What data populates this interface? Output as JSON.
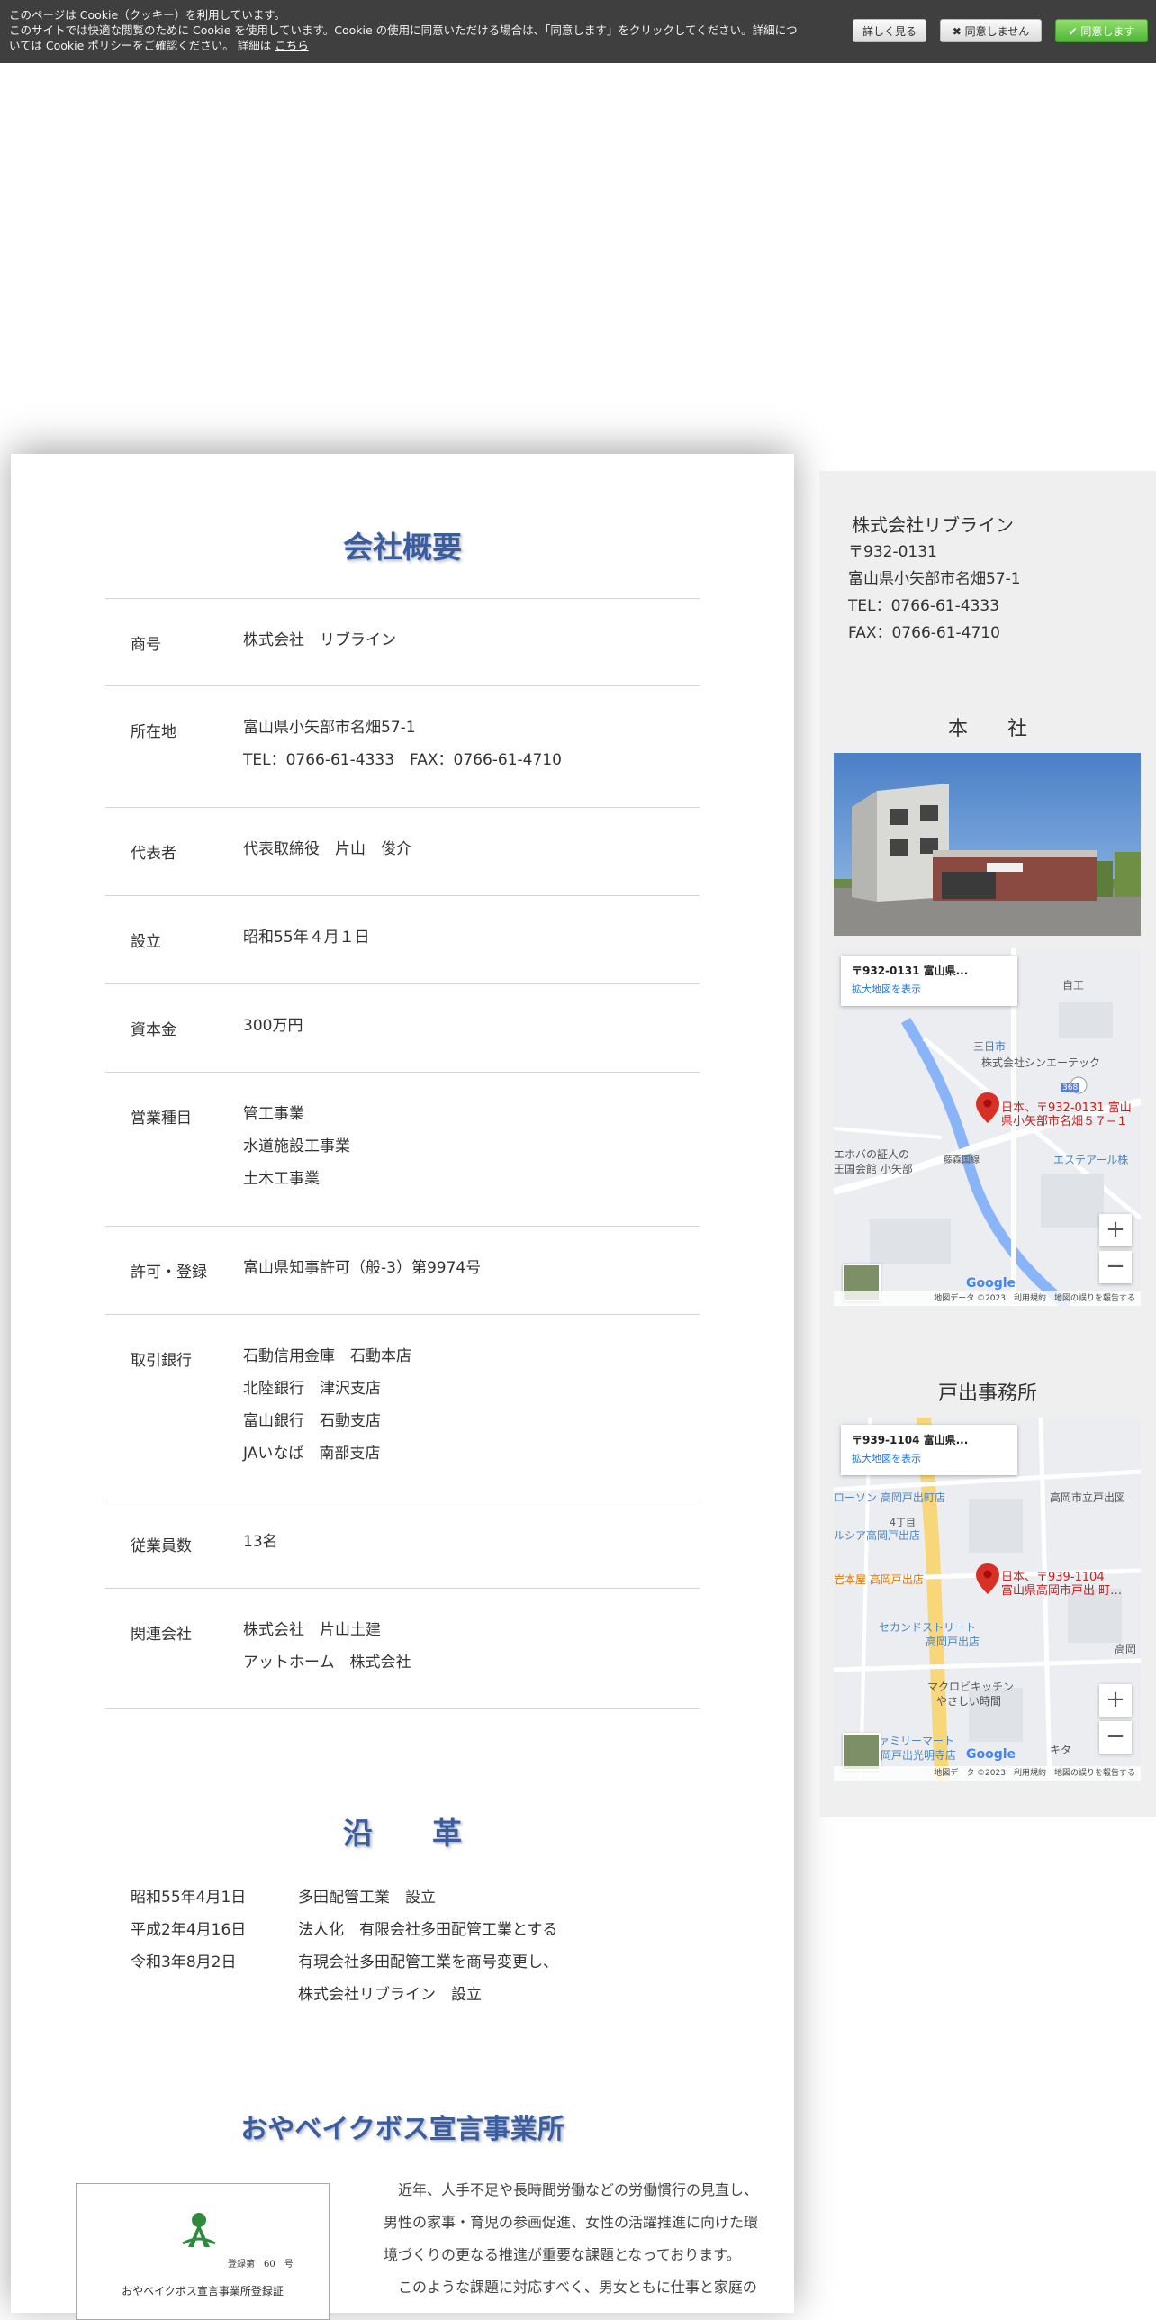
{
  "cookie": {
    "line1": "このページは Cookie（クッキー）を利用しています。",
    "line2": "このサイトでは快適な閲覧のために Cookie を使用しています。Cookie の使用に同意いただける場合は、「同意します」をクリックしてください。詳細につ",
    "line3": "いては Cookie ポリシーをご確認ください。 詳細は",
    "link": "こちら",
    "details_btn": "詳しく見る",
    "decline_btn": "✖ 同意しません",
    "accept_btn": "✔ 同意します"
  },
  "overview": {
    "title": "会社概要",
    "rows": [
      {
        "label": "商号",
        "lines": [
          "株式会社　リブライン"
        ]
      },
      {
        "label": "所在地",
        "lines": [
          "富山県小矢部市名畑57-1",
          "TEL：0766-61-4333　FAX：0766-61-4710"
        ]
      },
      {
        "label": "代表者",
        "lines": [
          "代表取締役　片山　俊介"
        ]
      },
      {
        "label": "設立",
        "lines": [
          "昭和55年４月１日"
        ]
      },
      {
        "label": "資本金",
        "lines": [
          "300万円"
        ]
      },
      {
        "label": "営業種目",
        "lines": [
          "管工事業",
          "水道施設工事業",
          "土木工事業"
        ]
      },
      {
        "label": "許可・登録",
        "lines": [
          "富山県知事許可（般-3）第9974号"
        ]
      },
      {
        "label": "取引銀行",
        "lines": [
          "石動信用金庫　石動本店",
          "北陸銀行　津沢支店",
          "富山銀行　石動支店",
          "JAいなば　南部支店"
        ]
      },
      {
        "label": "従業員数",
        "lines": [
          "13名"
        ]
      },
      {
        "label": "関連会社",
        "lines": [
          " 株式会社　片山土建",
          " アットホーム　株式会社"
        ]
      }
    ]
  },
  "history": {
    "title": "沿　　革",
    "rows": [
      {
        "date": "昭和55年4月1日",
        "event": "多田配管工業　設立"
      },
      {
        "date": "平成2年4月16日",
        "event": "法人化　有限会社多田配管工業とする"
      },
      {
        "date": "令和3年8月2日",
        "event": "有現会社多田配管工業を商号変更し、"
      },
      {
        "date": "",
        "event": "株式会社リブライン　設立"
      }
    ]
  },
  "kids": {
    "title": "おやベイクボス宣言事業所",
    "cert_number": "登録第　60　号",
    "cert_title": "おやベイクボス宣言事業所登録証",
    "paragraph1": "近年、人手不足や長時間労働などの労働慣行の見直し、男性の家事・育児の参画促進、女性の活躍推進に向けた環境づくりの更なる推進が重要な課題となっております。",
    "paragraph2": "このような課題に対応すべく、男女ともに仕事と家庭の"
  },
  "sidebar": {
    "company": "株式会社リブライン",
    "postal": "〒932-0131",
    "address": "富山県小矢部市名畑57-1",
    "tel": "TEL：0766-61-4333",
    "fax": "FAX：0766-61-4710",
    "head_office_title": "本　　社",
    "branch_title": "戸出事務所",
    "map1": {
      "card_addr": "〒932-0131 富山県...",
      "card_link": "拡大地図を表示",
      "pin_label_1": "日本、〒932-0131 富山",
      "pin_label_2": "県小矢部市名畑５７−１",
      "labels": [
        "株式会社シンエーテック",
        "エステアール株",
        "三日市",
        "自工",
        "エホバの証人の",
        "王国会館 小矢部",
        "藤森国線"
      ],
      "road_no": "368",
      "footer": "地図データ ©2023　利用規約　地図の誤りを報告する"
    },
    "map2": {
      "card_addr": "〒939-1104 富山県...",
      "card_link": "拡大地図を表示",
      "pin_label_1": "日本、〒939-1104",
      "pin_label_2": "富山県高岡市戸出 町…",
      "labels": [
        "ローソン 高岡戸出町店",
        "高岡市立戸出図",
        "4丁目",
        "ルシア高岡戸出店",
        "岩本屋 高岡戸出店",
        "セカンドストリート",
        "高岡戸出店",
        "マクロビキッチン",
        "やさしい時間",
        "ァミリーマート",
        "岡戸出光明寺店",
        "高岡",
        "キタ"
      ],
      "footer": "地図データ ©2023　利用規約　地図の誤りを報告する"
    }
  }
}
